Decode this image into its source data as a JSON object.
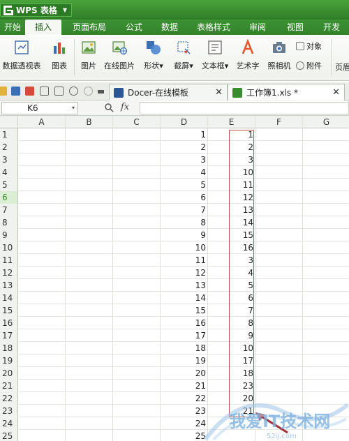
{
  "app": {
    "name": "WPS 表格",
    "caret": "▼"
  },
  "menu": [
    {
      "label": "开始",
      "w": 36
    },
    {
      "label": "插入",
      "w": 52,
      "active": true
    },
    {
      "label": "页面布局",
      "w": 80
    },
    {
      "label": "公式",
      "w": 48
    },
    {
      "label": "数据",
      "w": 54
    },
    {
      "label": "表格样式",
      "w": 72
    },
    {
      "label": "审阅",
      "w": 54
    },
    {
      "label": "视图",
      "w": 54
    },
    {
      "label": "开发",
      "w": 50
    }
  ],
  "ribbon": {
    "pivot": "数据透视表",
    "chart": "图表",
    "picture": "图片",
    "online_picture": "在线图片",
    "shapes": "形状",
    "screenshot": "截屏",
    "textbox": "文本框",
    "wordart": "艺术字",
    "camera": "照相机",
    "object": "对象",
    "attachment": "附件",
    "header": "页眉",
    "dropdown_caret": "▾"
  },
  "tabs": {
    "docer": "Docer-在线模板",
    "workbook": "工作簿1.xls *",
    "close": "✕"
  },
  "formula_bar": {
    "name_box": "K6",
    "fx": "fx",
    "formula": ""
  },
  "columns": [
    "A",
    "B",
    "C",
    "D",
    "E",
    "F",
    "G"
  ],
  "rows": [
    "1",
    "2",
    "3",
    "4",
    "5",
    "6",
    "7",
    "8",
    "9",
    "10",
    "11",
    "12",
    "13",
    "14",
    "15",
    "16",
    "17",
    "18",
    "19",
    "20",
    "21",
    "22",
    "23",
    "24",
    "25"
  ],
  "selected_row": "6",
  "col_d": [
    "1",
    "2",
    "3",
    "4",
    "5",
    "6",
    "7",
    "8",
    "9",
    "10",
    "11",
    "12",
    "13",
    "14",
    "15",
    "16",
    "17",
    "18",
    "19",
    "20",
    "21",
    "22",
    "23",
    "24",
    "25"
  ],
  "col_e": [
    "1",
    "2",
    "3",
    "10",
    "11",
    "12",
    "13",
    "14",
    "15",
    "16",
    "3",
    "4",
    "5",
    "6",
    "7",
    "8",
    "9",
    "10",
    "17",
    "18",
    "23",
    "20",
    "21",
    "",
    ""
  ],
  "watermark": {
    "text": "我爱IT技术网",
    "sub": "52ij.com"
  },
  "colors": {
    "accent": "#3a8b2f",
    "highlight": "#c0504d",
    "arrow": "#a0303a"
  }
}
